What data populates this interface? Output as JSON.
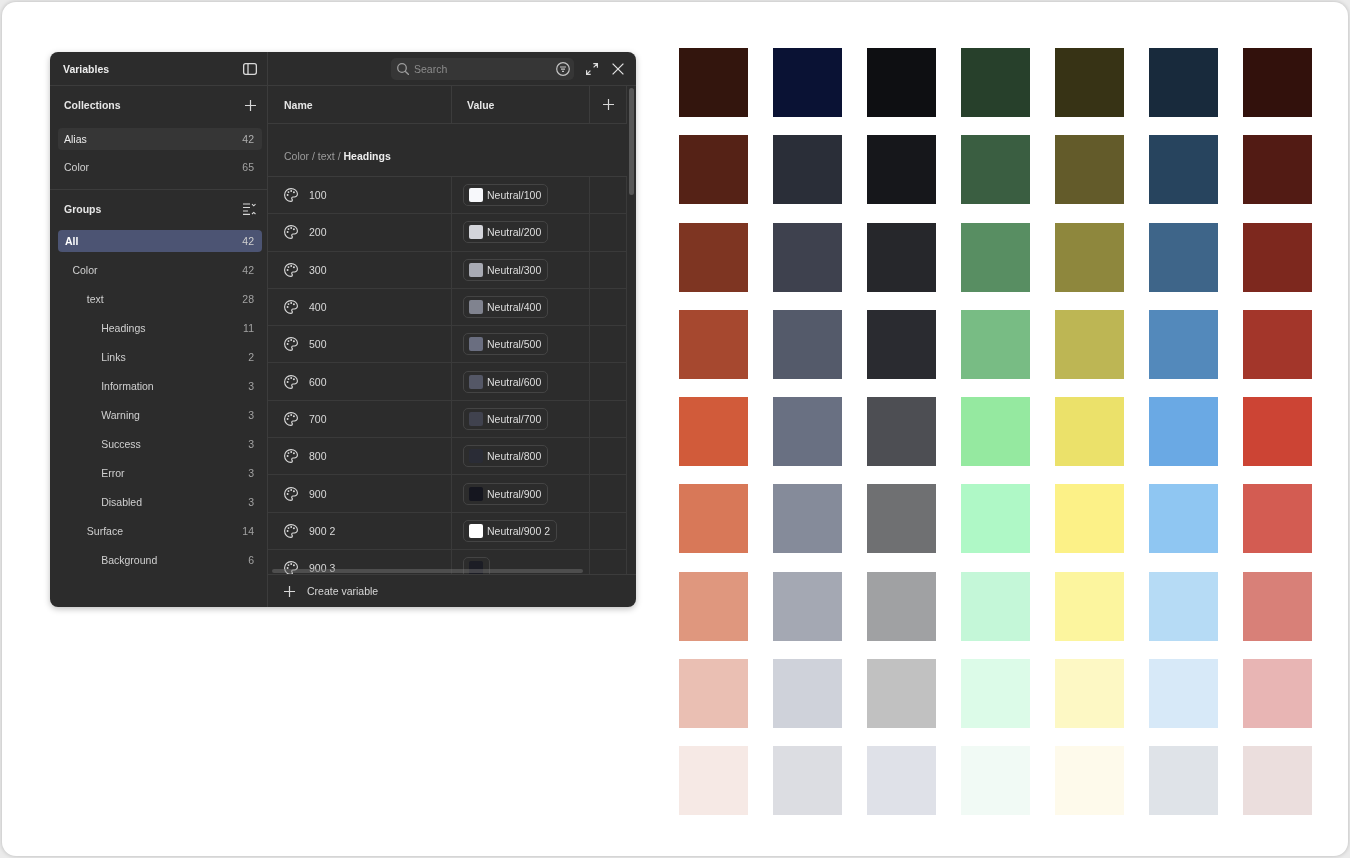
{
  "variables_panel": {
    "title": "Variables",
    "collections": {
      "title": "Collections",
      "items": [
        {
          "label": "Alias",
          "count": "42",
          "selected": true
        },
        {
          "label": "Color",
          "count": "65",
          "selected": false
        }
      ]
    },
    "groups": {
      "title": "Groups",
      "items": [
        {
          "label": "All",
          "count": "42",
          "selected": true,
          "children": [
            {
              "label": "Color",
              "count": "42",
              "selected": false,
              "children": [
                {
                  "label": "text",
                  "count": "28",
                  "selected": false,
                  "children": [
                    {
                      "label": "Headings",
                      "count": "11",
                      "selected": false
                    },
                    {
                      "label": "Links",
                      "count": "2",
                      "selected": false
                    },
                    {
                      "label": "Information",
                      "count": "3",
                      "selected": false
                    },
                    {
                      "label": "Warning",
                      "count": "3",
                      "selected": false
                    },
                    {
                      "label": "Success",
                      "count": "3",
                      "selected": false
                    },
                    {
                      "label": "Error",
                      "count": "3",
                      "selected": false
                    },
                    {
                      "label": "Disabled",
                      "count": "3",
                      "selected": false
                    }
                  ]
                },
                {
                  "label": "Surface",
                  "count": "14",
                  "selected": false,
                  "children": [
                    {
                      "label": "Background",
                      "count": "6",
                      "selected": false
                    }
                  ]
                }
              ]
            }
          ]
        }
      ]
    },
    "search": {
      "placeholder": "Search"
    },
    "table": {
      "columns": [
        "Name",
        "Value"
      ],
      "group_path": "Color / text / **Headings**",
      "rows": [
        {
          "name": "100",
          "value": "Neutral/100",
          "color": "#f7f8fb"
        },
        {
          "name": "200",
          "value": "Neutral/200",
          "color": "#d3d4da"
        },
        {
          "name": "300",
          "value": "Neutral/300",
          "color": "#a8aab3"
        },
        {
          "name": "400",
          "value": "Neutral/400",
          "color": "#80838f"
        },
        {
          "name": "500",
          "value": "Neutral/500",
          "color": "#6a6e80"
        },
        {
          "name": "600",
          "value": "Neutral/600",
          "color": "#545766"
        },
        {
          "name": "700",
          "value": "Neutral/700",
          "color": "#40424e"
        },
        {
          "name": "800",
          "value": "Neutral/800",
          "color": "#2a2c36"
        },
        {
          "name": "900",
          "value": "Neutral/900",
          "color": "#15161f"
        },
        {
          "name": "900 2",
          "value": "Neutral/900 2",
          "color": "#ffffff"
        },
        {
          "name": "900 3",
          "color": "#1c1d25"
        }
      ]
    },
    "footer_action": "Create variable"
  },
  "color_grid": {
    "rows": [
      {
        "swatches": [
          {
            "color": "#33150d"
          },
          {
            "color": "#0a1234"
          },
          {
            "color": "#0e0f12"
          },
          {
            "color": "#27402b"
          },
          {
            "color": "#373315"
          },
          {
            "color": "#182a3c"
          },
          {
            "color": "#32110c"
          }
        ]
      },
      {
        "swatches": [
          {
            "color": "#552216"
          },
          {
            "color": "#2a2e38"
          },
          {
            "color": "#16171b"
          },
          {
            "color": "#3a5e41"
          },
          {
            "color": "#635b2a"
          },
          {
            "color": "#27445e"
          },
          {
            "color": "#521b14"
          }
        ]
      },
      {
        "swatches": [
          {
            "color": "#7e3522"
          },
          {
            "color": "#3e414e"
          },
          {
            "color": "#26272b"
          },
          {
            "color": "#588e62"
          },
          {
            "color": "#8e873d"
          },
          {
            "color": "#3e6589"
          },
          {
            "color": "#7d281e"
          }
        ]
      },
      {
        "swatches": [
          {
            "color": "#a6482f"
          },
          {
            "color": "#545a6a"
          },
          {
            "color": "#2a2b30"
          },
          {
            "color": "#78bc84"
          },
          {
            "color": "#bdb654"
          },
          {
            "color": "#5389bb"
          },
          {
            "color": "#a3362a"
          }
        ]
      },
      {
        "swatches": [
          {
            "color": "#d15b3a"
          },
          {
            "color": "#697082"
          },
          {
            "color": "#4d4e53"
          },
          {
            "color": "#95e9a0"
          },
          {
            "color": "#ebe16a"
          },
          {
            "color": "#6aa9e4"
          },
          {
            "color": "#cc4434"
          }
        ]
      },
      {
        "swatches": [
          {
            "color": "#d87858"
          },
          {
            "color": "#858b9a"
          },
          {
            "color": "#6f7072"
          },
          {
            "color": "#aff8c6"
          },
          {
            "color": "#fcf187"
          },
          {
            "color": "#8fc6f2"
          },
          {
            "color": "#d35c52"
          }
        ]
      },
      {
        "swatches": [
          {
            "color": "#df977e"
          },
          {
            "color": "#a4a8b3"
          },
          {
            "color": "#a0a1a3"
          },
          {
            "color": "#c4f7d8"
          },
          {
            "color": "#fcf59e"
          },
          {
            "color": "#b6dbf5"
          },
          {
            "color": "#d88078"
          }
        ]
      },
      {
        "swatches": [
          {
            "color": "#eabfb3"
          },
          {
            "color": "#cfd2da"
          },
          {
            "color": "#c1c1c1"
          },
          {
            "color": "#dcfbe8"
          },
          {
            "color": "#fdf8c4"
          },
          {
            "color": "#d7e9f8"
          },
          {
            "color": "#e8b5b4"
          }
        ]
      },
      {
        "swatches": [
          {
            "color": "#f6e9e5"
          },
          {
            "color": "#dcdde2"
          },
          {
            "color": "#dfe1e8"
          },
          {
            "color": "#f1faf5"
          },
          {
            "color": "#fefaeb"
          },
          {
            "color": "#dfe3e8"
          },
          {
            "color": "#ebdedd"
          }
        ]
      }
    ]
  }
}
